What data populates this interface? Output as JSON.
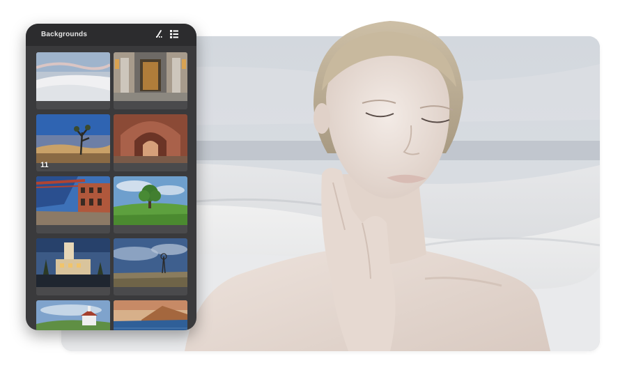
{
  "panel": {
    "title": "Backgrounds",
    "icons": [
      "brush-icon",
      "list-icon"
    ],
    "thumbnails": [
      {
        "name": "white-sand-dunes",
        "count": ""
      },
      {
        "name": "marble-hallway",
        "count": ""
      },
      {
        "name": "joshua-tree-desert",
        "count": "11"
      },
      {
        "name": "brick-arches-tunnel",
        "count": ""
      },
      {
        "name": "bridge-fort-courtyard",
        "count": ""
      },
      {
        "name": "green-meadow-tree",
        "count": ""
      },
      {
        "name": "art-deco-building",
        "count": ""
      },
      {
        "name": "windmill-prairie",
        "count": ""
      },
      {
        "name": "chapel-hillside",
        "count": ""
      },
      {
        "name": "lake-mountains",
        "count": ""
      }
    ]
  },
  "colors": {
    "panel_bg": "#3a3a3c",
    "panel_header": "#2c2c2e",
    "canvas_sky": "#d7dbe1",
    "skin": "#e4d8d1"
  }
}
